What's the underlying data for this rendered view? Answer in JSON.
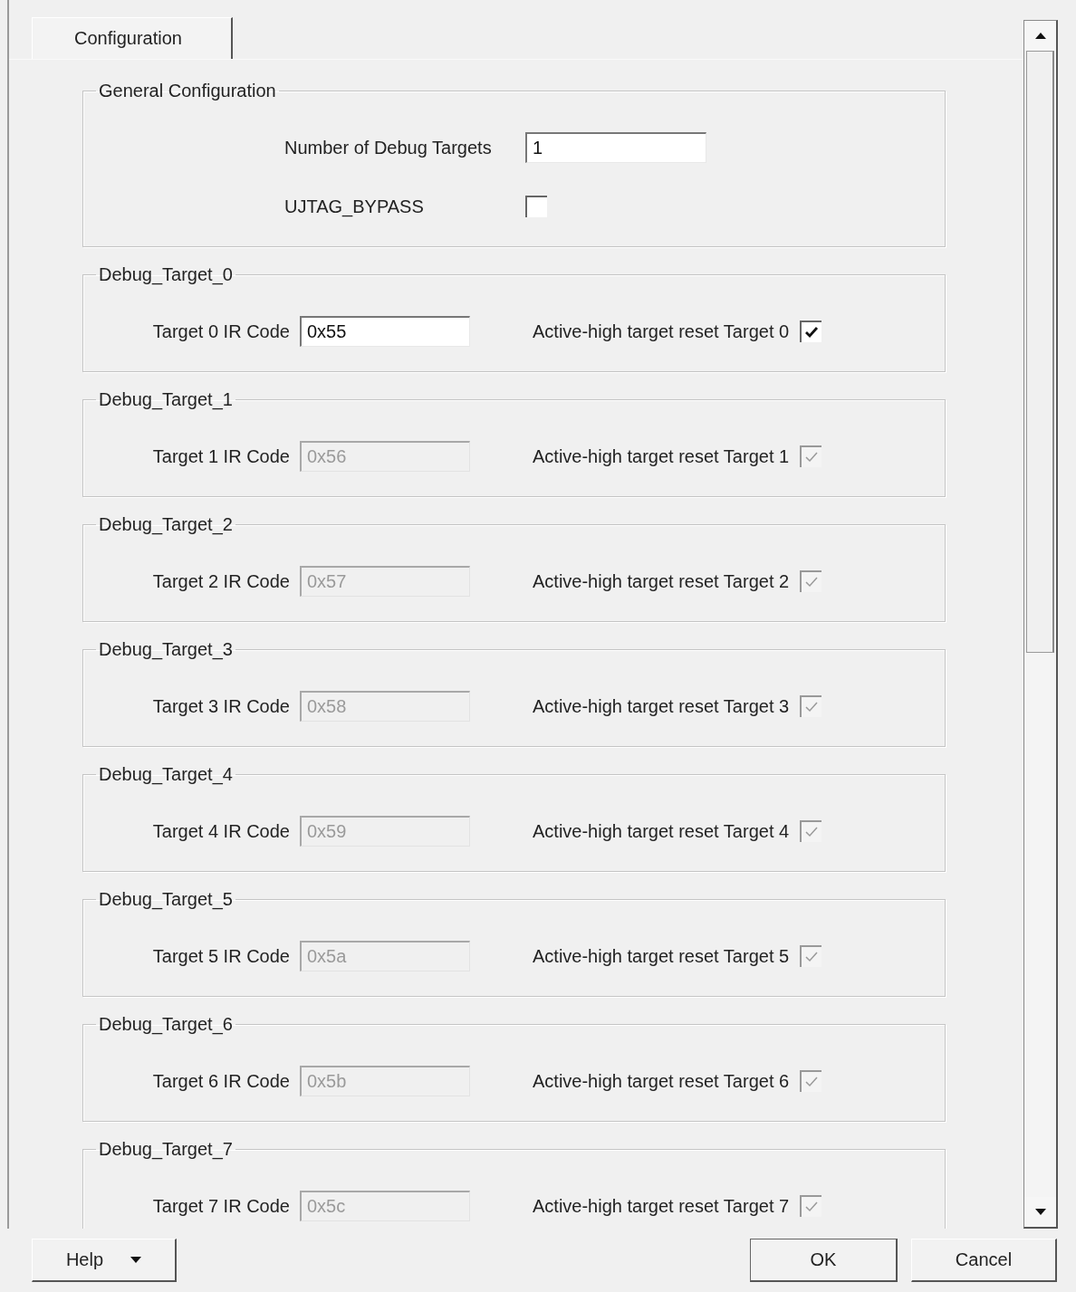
{
  "tab": {
    "label": "Configuration",
    "selected": true
  },
  "general": {
    "title": "General Configuration",
    "number_of_targets": {
      "label": "Number of Debug Targets",
      "value": "1"
    },
    "ujtag_bypass": {
      "label": "UJTAG_BYPASS",
      "checked": false
    }
  },
  "targets": [
    {
      "title": "Debug_Target_0",
      "ir_label": "Target 0 IR Code",
      "ir_value": "0x55",
      "reset_label": "Active-high target reset Target 0",
      "checked": true,
      "disabled": false
    },
    {
      "title": "Debug_Target_1",
      "ir_label": "Target 1 IR Code",
      "ir_value": "0x56",
      "reset_label": "Active-high target reset Target 1",
      "checked": true,
      "disabled": true
    },
    {
      "title": "Debug_Target_2",
      "ir_label": "Target 2 IR Code",
      "ir_value": "0x57",
      "reset_label": "Active-high target reset Target 2",
      "checked": true,
      "disabled": true
    },
    {
      "title": "Debug_Target_3",
      "ir_label": "Target 3 IR Code",
      "ir_value": "0x58",
      "reset_label": "Active-high target reset Target 3",
      "checked": true,
      "disabled": true
    },
    {
      "title": "Debug_Target_4",
      "ir_label": "Target 4 IR Code",
      "ir_value": "0x59",
      "reset_label": "Active-high target reset Target 4",
      "checked": true,
      "disabled": true
    },
    {
      "title": "Debug_Target_5",
      "ir_label": "Target 5 IR Code",
      "ir_value": "0x5a",
      "reset_label": "Active-high target reset Target 5",
      "checked": true,
      "disabled": true
    },
    {
      "title": "Debug_Target_6",
      "ir_label": "Target 6 IR Code",
      "ir_value": "0x5b",
      "reset_label": "Active-high target reset Target 6",
      "checked": true,
      "disabled": true
    },
    {
      "title": "Debug_Target_7",
      "ir_label": "Target 7 IR Code",
      "ir_value": "0x5c",
      "reset_label": "Active-high target reset Target 7",
      "checked": true,
      "disabled": true
    }
  ],
  "buttons": {
    "help": "Help",
    "ok": "OK",
    "cancel": "Cancel"
  }
}
